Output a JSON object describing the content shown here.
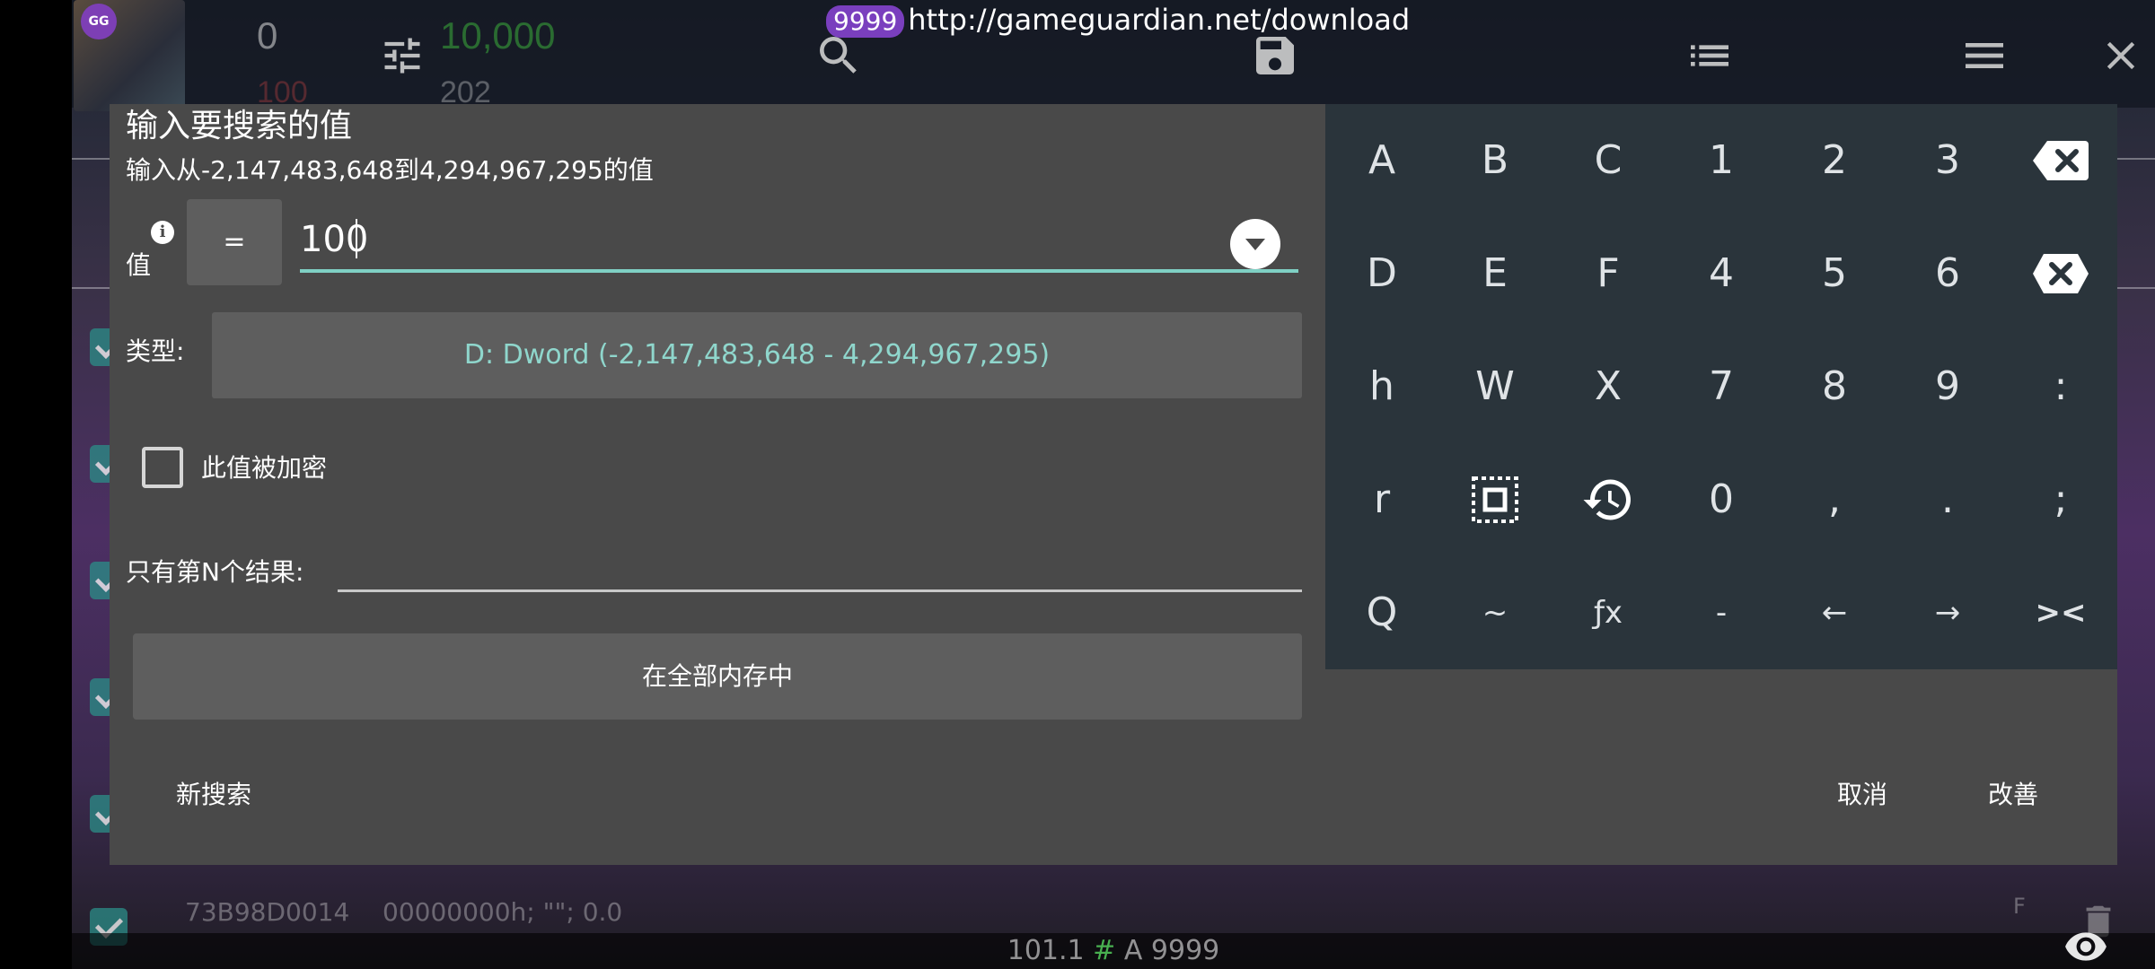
{
  "header": {
    "badge": "9999",
    "url": "http://gameguardian.net/download"
  },
  "background": {
    "counter_left": "0",
    "counter_right": "10,000",
    "counter_left_2": "100",
    "counter_right_2": "202",
    "bottom_row": {
      "address": "73B98D0014",
      "value": "00000000h; \"\"; 0.0",
      "flag": "F"
    },
    "status": {
      "prefix": "101.1",
      "hash": "#",
      "suffix": "A 9999"
    }
  },
  "dialog": {
    "title": "输入要搜索的值",
    "subtitle": "输入从-2,147,483,648到4,294,967,295的值",
    "value_label": "值",
    "operator": "=",
    "value": "100",
    "type_label": "类型:",
    "type_value": "D: Dword (-2,147,483,648 - 4,294,967,295)",
    "encrypted_label": "此值被加密",
    "encrypted_checked": false,
    "nth_label": "只有第N个结果:",
    "nth_value": "",
    "memory_button": "在全部内存中",
    "footer": {
      "new_search": "新搜索",
      "cancel": "取消",
      "refine": "改善"
    }
  },
  "keypad": {
    "rows": [
      [
        "A",
        "B",
        "C",
        "1",
        "2",
        "3",
        "backspace-icon"
      ],
      [
        "D",
        "E",
        "F",
        "4",
        "5",
        "6",
        "clear-icon"
      ],
      [
        "h",
        "W",
        "X",
        "7",
        "8",
        "9",
        ":"
      ],
      [
        "r",
        "select-icon",
        "history-icon",
        "0",
        ",",
        ".",
        ";"
      ],
      [
        "Q",
        "~",
        "ƒx",
        "-",
        "←",
        "→",
        "><"
      ]
    ]
  },
  "colors": {
    "dialog_bg": "#494949",
    "keypad_bg": "#2a343b",
    "accent": "#7fd0c4",
    "type_text": "#8fd6cc",
    "badge": "#7a3fbe"
  }
}
